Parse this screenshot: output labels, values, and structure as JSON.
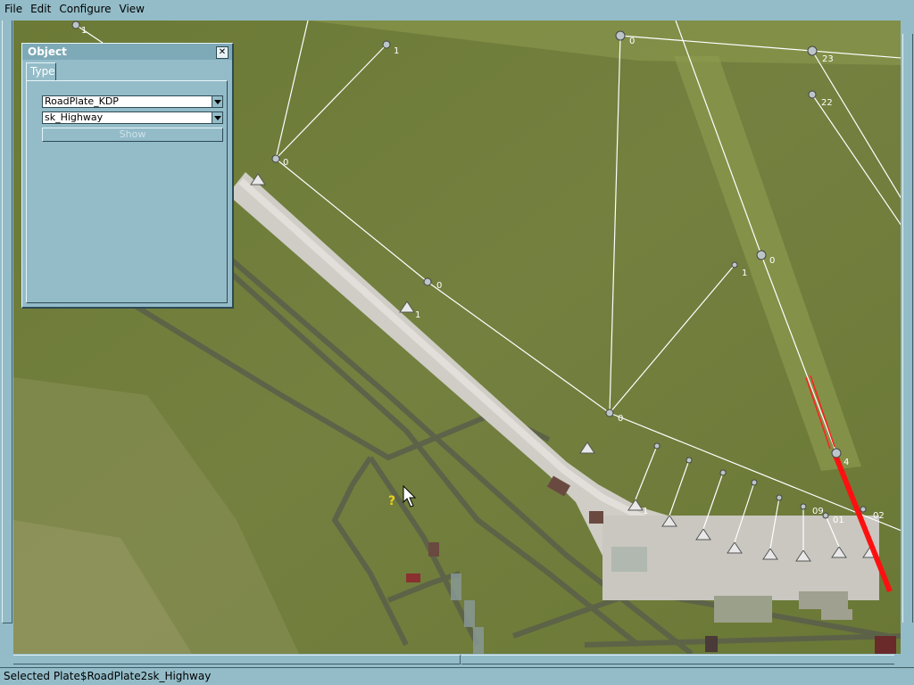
{
  "menu": [
    "File",
    "Edit",
    "Configure",
    "View"
  ],
  "object_panel": {
    "title": "Object",
    "close_glyph": "✕",
    "tab": "Type",
    "plate_select": "RoadPlate_KDP",
    "type_select": "sk_Highway",
    "show_button": "Show"
  },
  "status": "Selected Plate$RoadPlate2sk_Highway",
  "map_labels": {
    "l1": "1",
    "l2": "1",
    "l3": "0",
    "l4": "1",
    "l5": "0",
    "l6": "0",
    "l23": "23",
    "l22": "22",
    "l_1b": "1",
    "l_0c": "0",
    "l_0d": "0",
    "l_4": "4",
    "l_02": "02",
    "l_1c": "1",
    "l_09": "09",
    "l_01": "01",
    "q": "?"
  },
  "colors": {
    "grass": "#6f7b3a",
    "runway": "#d8d6d0",
    "selected_road": "#ff1010",
    "ui": "#93bcc8"
  }
}
